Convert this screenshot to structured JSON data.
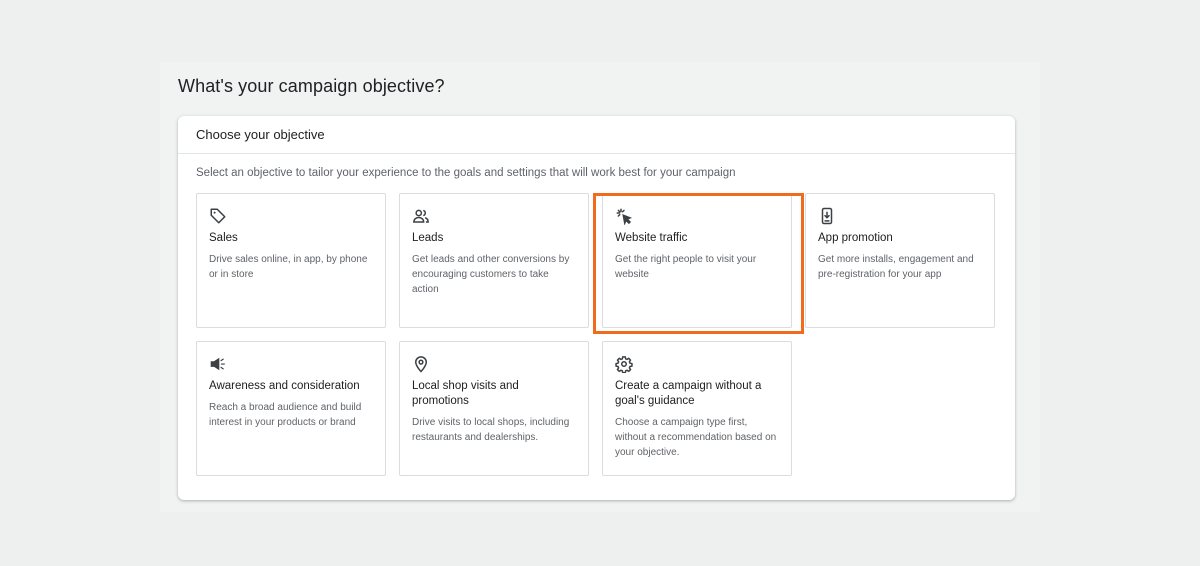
{
  "page_title": "What's your campaign objective?",
  "panel": {
    "header": "Choose your objective",
    "description": "Select an objective to tailor your experience to the goals and settings that will work best for your campaign"
  },
  "objectives": [
    {
      "id": "sales",
      "icon": "tag-icon",
      "title": "Sales",
      "description": "Drive sales online, in app, by phone or in store"
    },
    {
      "id": "leads",
      "icon": "people-icon",
      "title": "Leads",
      "description": "Get leads and other conversions by encouraging customers to take action"
    },
    {
      "id": "website-traffic",
      "icon": "cursor-click-icon",
      "title": "Website traffic",
      "description": "Get the right people to visit your website",
      "highlighted": true
    },
    {
      "id": "app-promotion",
      "icon": "phone-download-icon",
      "title": "App promotion",
      "description": "Get more installs, engagement and pre-registration for your app"
    },
    {
      "id": "awareness",
      "icon": "megaphone-icon",
      "title": "Awareness and consideration",
      "description": "Reach a broad audience and build interest in your products or brand"
    },
    {
      "id": "local-shop",
      "icon": "location-pin-icon",
      "title": "Local shop visits and promotions",
      "description": "Drive visits to local shops, including restaurants and dealerships."
    },
    {
      "id": "no-goal",
      "icon": "gear-icon",
      "title": "Create a campaign without a goal's guidance",
      "description": "Choose a campaign type first, without a recommendation based on your objective."
    }
  ],
  "colors": {
    "highlight": "#f26a1b",
    "icon": "#5f6368"
  }
}
